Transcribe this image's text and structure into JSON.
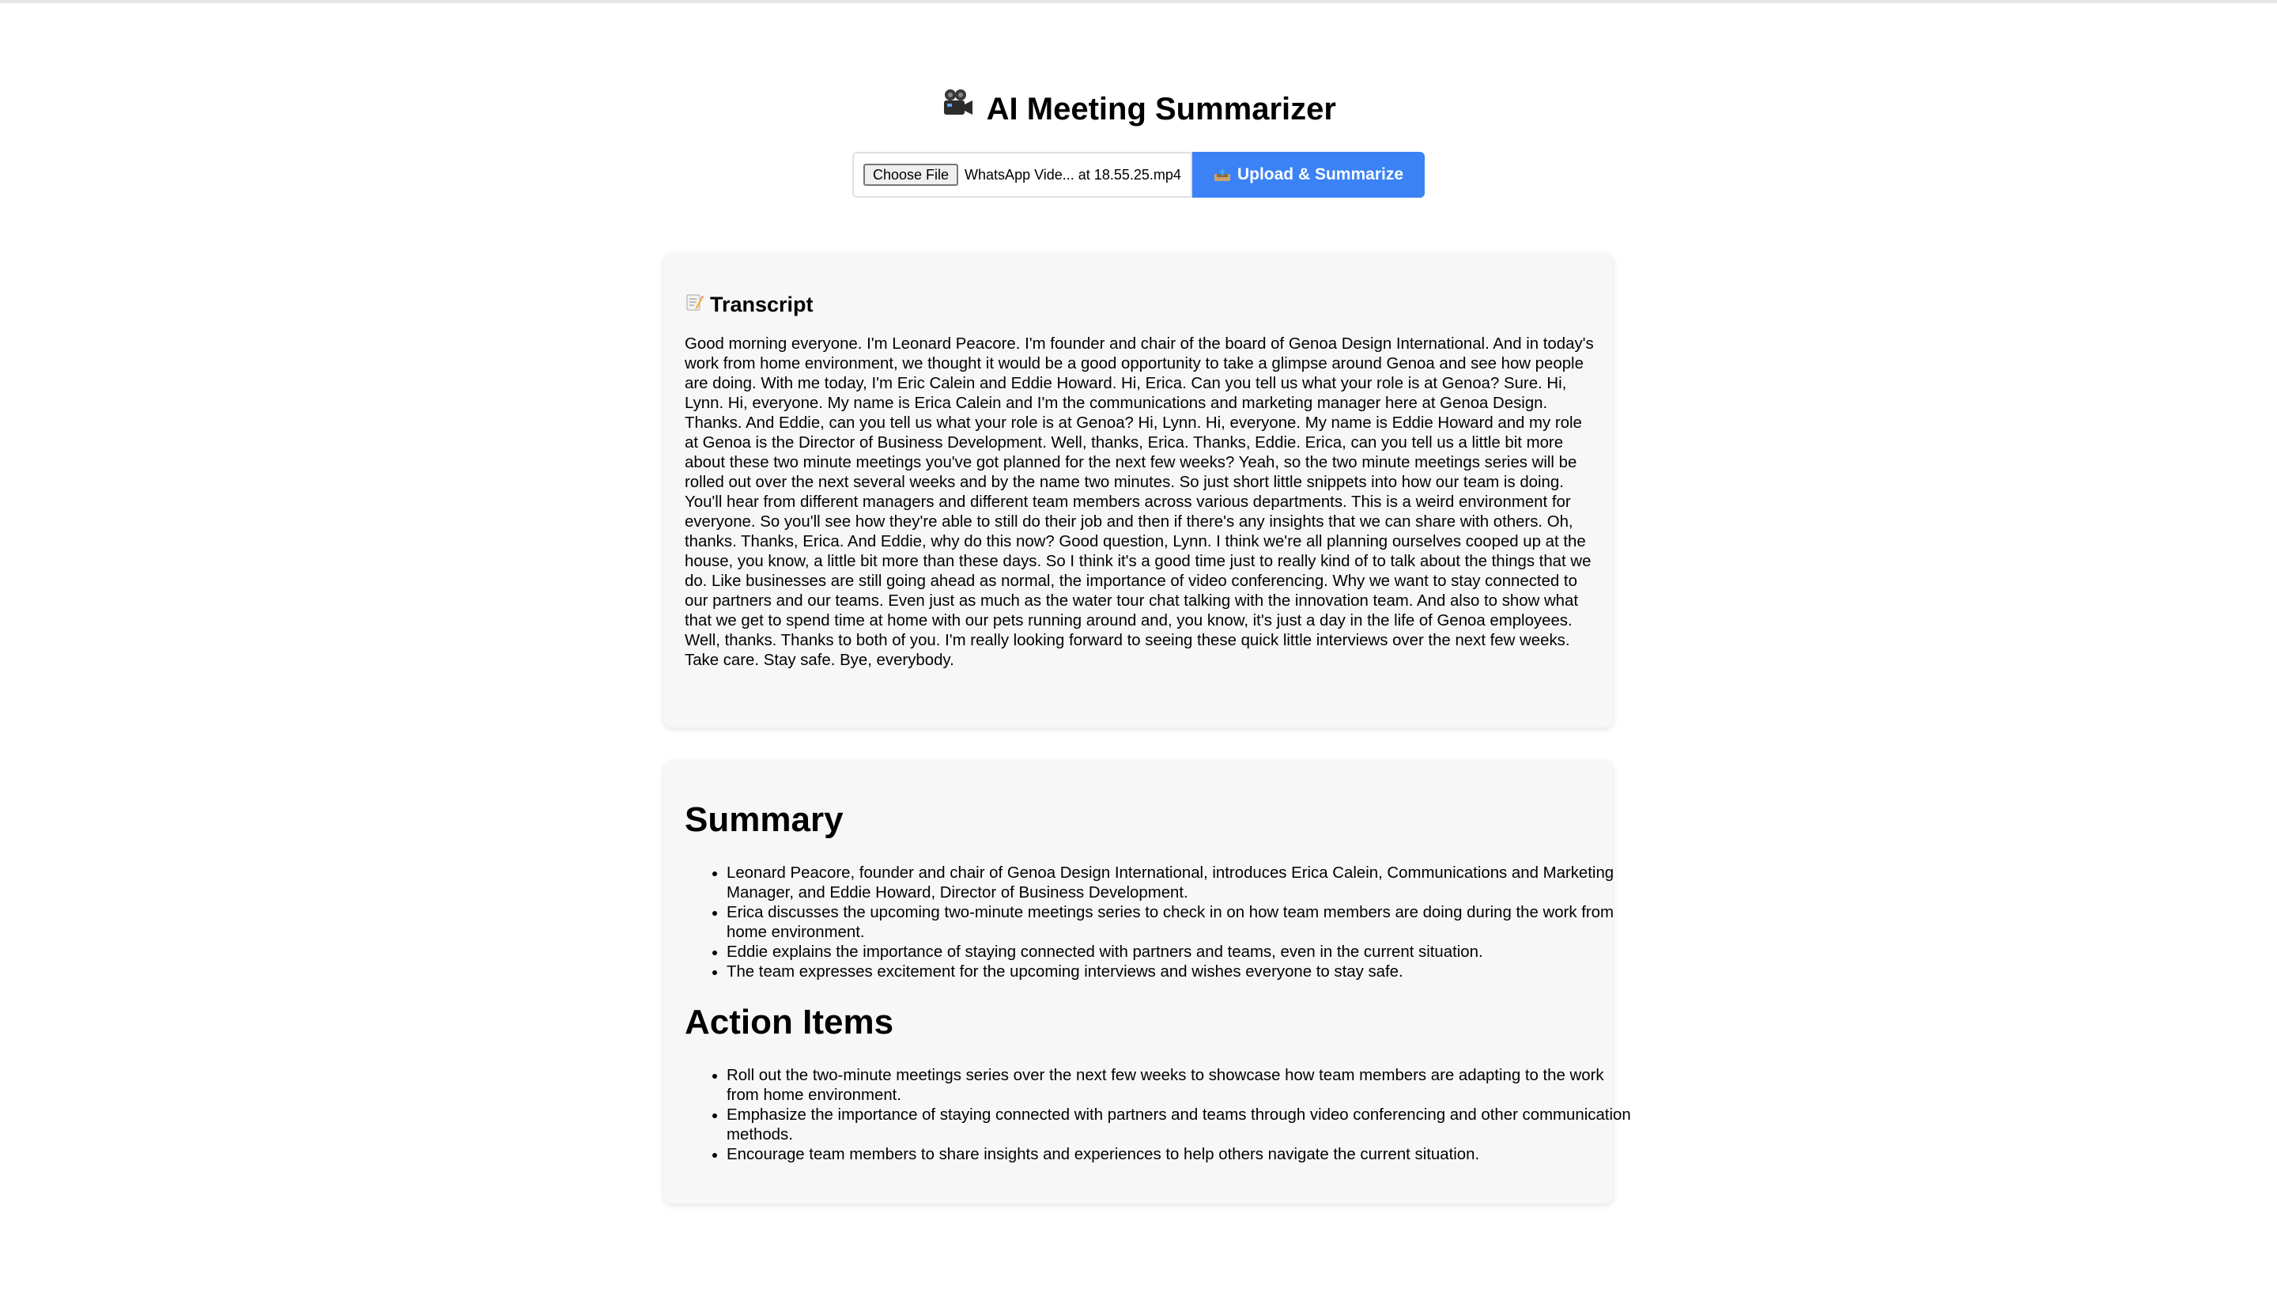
{
  "header": {
    "title_icon": "movie-camera-icon",
    "title": "AI Meeting Summarizer"
  },
  "upload": {
    "choose_label": "Choose File",
    "file_name": "WhatsApp Vide... at 18.55.25.mp4",
    "button_icon": "inbox-tray-icon",
    "button_label": "Upload & Summarize",
    "accent_color": "#3b82f6"
  },
  "transcript": {
    "icon": "memo-icon",
    "heading": "Transcript",
    "text": "Good morning everyone. I'm Leonard Peacore. I'm founder and chair of the board of Genoa Design International. And in today's work from home environment, we thought it would be a good opportunity to take a glimpse around Genoa and see how people are doing. With me today, I'm Eric Calein and Eddie Howard. Hi, Erica. Can you tell us what your role is at Genoa? Sure. Hi, Lynn. Hi, everyone. My name is Erica Calein and I'm the communications and marketing manager here at Genoa Design. Thanks. And Eddie, can you tell us what your role is at Genoa? Hi, Lynn. Hi, everyone. My name is Eddie Howard and my role at Genoa is the Director of Business Development. Well, thanks, Erica. Thanks, Eddie. Erica, can you tell us a little bit more about these two minute meetings you've got planned for the next few weeks? Yeah, so the two minute meetings series will be rolled out over the next several weeks and by the name two minutes. So just short little snippets into how our team is doing. You'll hear from different managers and different team members across various departments. This is a weird environment for everyone. So you'll see how they're able to still do their job and then if there's any insights that we can share with others. Oh, thanks. Thanks, Erica. And Eddie, why do this now? Good question, Lynn. I think we're all planning ourselves cooped up at the house, you know, a little bit more than these days. So I think it's a good time just to really kind of to talk about the things that we do. Like businesses are still going ahead as normal, the importance of video conferencing. Why we want to stay connected to our partners and our teams. Even just as much as the water tour chat talking with the innovation team. And also to show what that we get to spend time at home with our pets running around and, you know, it's just a day in the life of Genoa employees. Well, thanks. Thanks to both of you. I'm really looking forward to seeing these quick little interviews over the next few weeks. Take care. Stay safe. Bye, everybody."
  },
  "summary": {
    "heading": "Summary",
    "items": [
      "Leonard Peacore, founder and chair of Genoa Design International, introduces Erica Calein, Communications and Marketing Manager, and Eddie Howard, Director of Business Development.",
      "Erica discusses the upcoming two-minute meetings series to check in on how team members are doing during the work from home environment.",
      "Eddie explains the importance of staying connected with partners and teams, even in the current situation.",
      "The team expresses excitement for the upcoming interviews and wishes everyone to stay safe."
    ]
  },
  "action_items": {
    "heading": "Action Items",
    "items": [
      "Roll out the two-minute meetings series over the next few weeks to showcase how team members are adapting to the work from home environment.",
      "Emphasize the importance of staying connected with partners and teams through video conferencing and other communication methods.",
      "Encourage team members to share insights and experiences to help others navigate the current situation."
    ]
  }
}
